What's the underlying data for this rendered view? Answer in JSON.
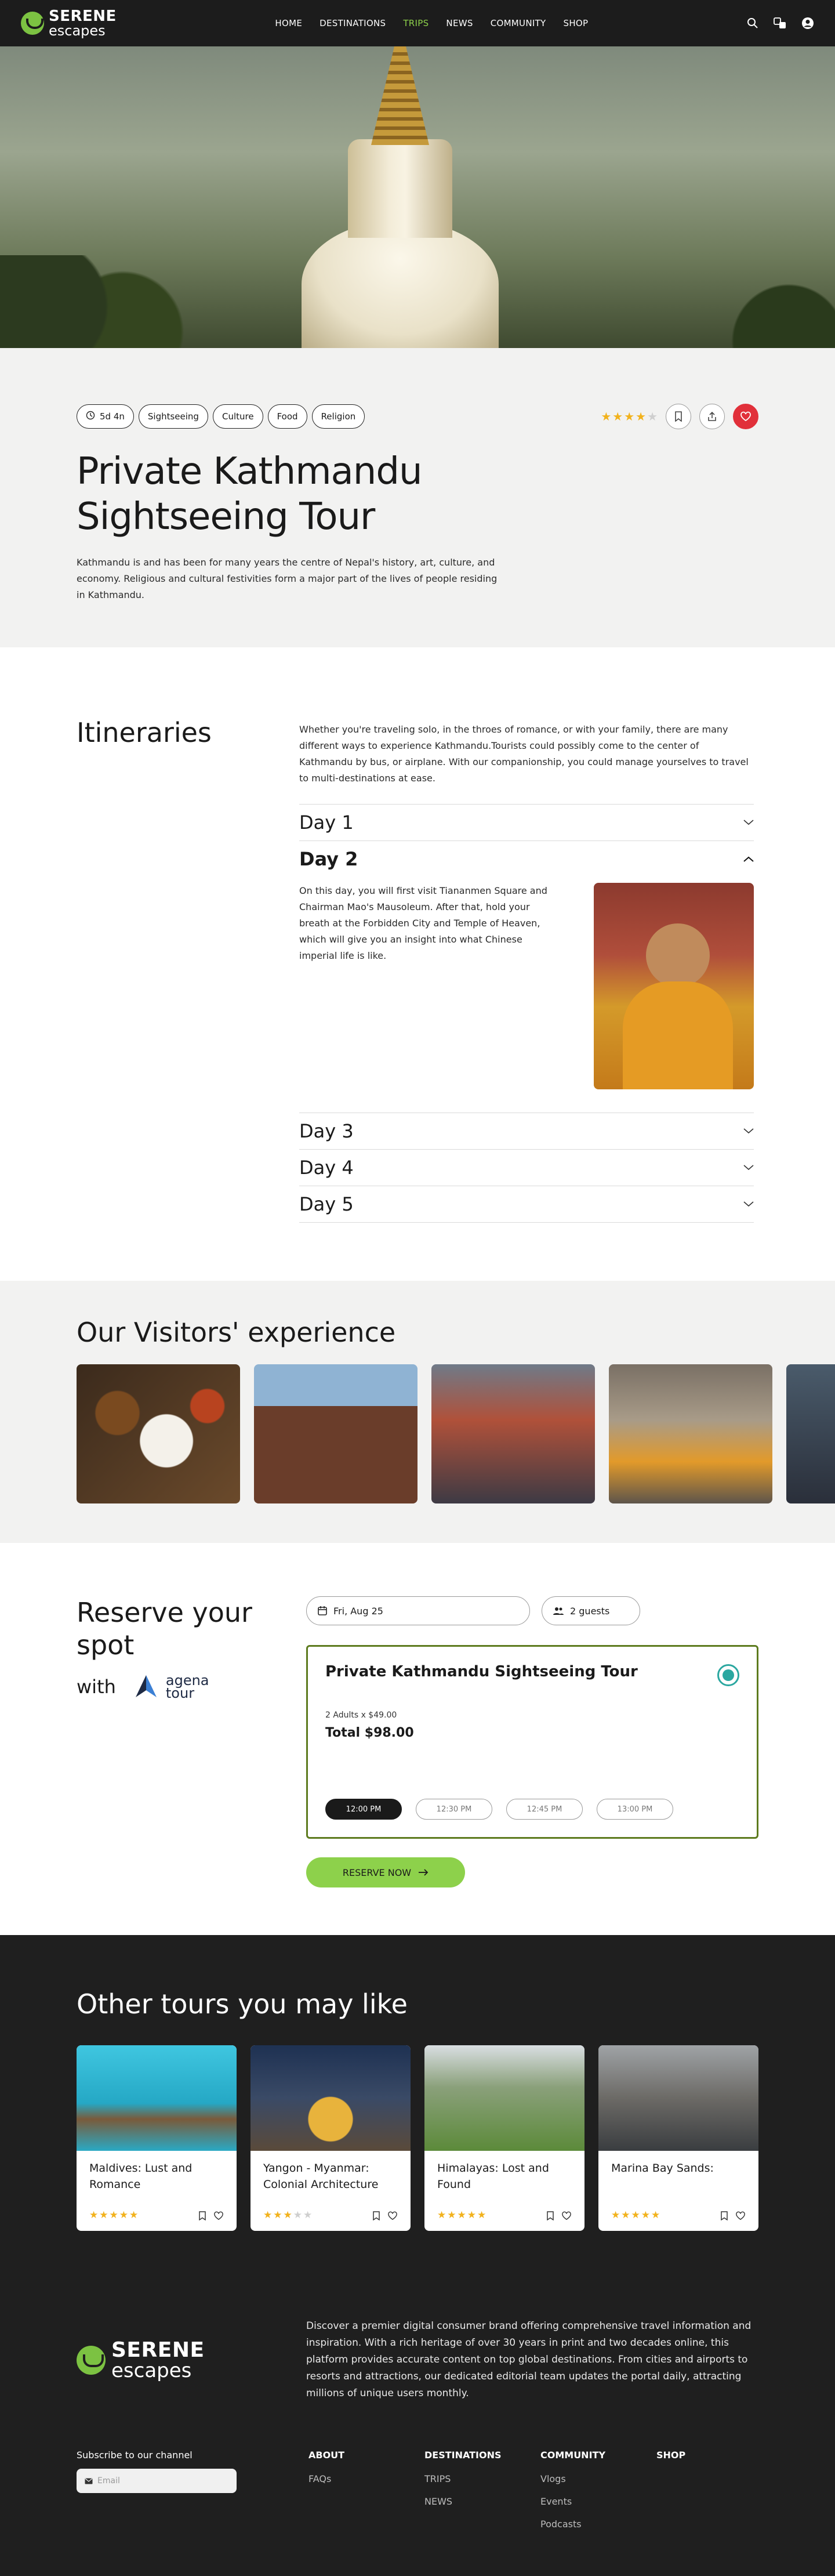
{
  "nav": {
    "logo_line1": "SERENE",
    "logo_line2": "escapes",
    "links": [
      "HOME",
      "DESTINATIONS",
      "TRIPS",
      "NEWS",
      "COMMUNITY",
      "SHOP"
    ],
    "active_link": "TRIPS",
    "icons": [
      "search-icon",
      "translate-icon",
      "account-icon"
    ]
  },
  "tour": {
    "tags": [
      "5d 4n",
      "Sightseeing",
      "Culture",
      "Food",
      "Religion"
    ],
    "rating": 4,
    "rating_max": 5,
    "title": "Private Kathmandu Sightseeing Tour",
    "description": "Kathmandu is and has been for many years the centre of Nepal's history, art, culture, and economy. Religious and cultural festivities form a major part of the lives of people residing in Kathmandu."
  },
  "itineraries": {
    "heading": "Itineraries",
    "intro": "Whether you're traveling solo, in the throes of romance, or with your family, there are many different ways to experience Kathmandu.Tourists could possibly come to the center of Kathmandu by bus, or airplane. With our companionship, you could manage yourselves to travel to multi-destinations at ease.",
    "days": [
      "Day 1",
      "Day 2",
      "Day 3",
      "Day 4",
      "Day 5"
    ],
    "open_day_text": "On this day, you will first visit Tiananmen Square and Chairman Mao's Mausoleum. After that, hold your breath at the Forbidden City and Temple of Heaven, which will give you an insight into what Chinese imperial life is like."
  },
  "visitors": {
    "heading": "Our Visitors' experience"
  },
  "reserve": {
    "heading": "Reserve your spot",
    "with_label": "with",
    "partner_line1": "agena",
    "partner_line2": "tour",
    "date_value": "Fri, Aug 25",
    "guests_value": "2 guests",
    "card_title": "Private Kathmandu Sightseeing Tour",
    "price_line": "2 Adults x $49.00",
    "total": "Total $98.00",
    "time_slots": [
      "12:00 PM",
      "12:30 PM",
      "12:45 PM",
      "13:00 PM"
    ],
    "selected_slot": "12:00 PM",
    "button_label": "RESERVE NOW",
    "accent_color": "#8dd14b",
    "border_color": "#5d7b1e"
  },
  "other_tours": {
    "heading": "Other tours you may like",
    "items": [
      {
        "name": "Maldives: Lust and Romance",
        "rating": 5
      },
      {
        "name": "Yangon - Myanmar: Colonial Architecture",
        "rating": 3
      },
      {
        "name": "Himalayas: Lost and Found",
        "rating": 5
      },
      {
        "name": "Marina Bay Sands:",
        "rating": 5
      }
    ]
  },
  "footer": {
    "logo_line1": "SERENE",
    "logo_line2": "escapes",
    "about": "Discover a premier digital consumer brand offering comprehensive travel information and inspiration. With a rich heritage of over 30 years in print and two decades online, this platform provides accurate content on top global destinations. From cities and airports to resorts and attractions, our dedicated editorial team updates the portal daily, attracting millions of unique users monthly.",
    "subscribe_label": "Subscribe to our channel",
    "email_placeholder": "Email",
    "columns": [
      {
        "heading": "ABOUT",
        "items": [
          "FAQs"
        ]
      },
      {
        "heading": "DESTINATIONS",
        "items": [
          "TRIPS",
          "NEWS"
        ]
      },
      {
        "heading": "COMMUNITY",
        "items": [
          "Vlogs",
          "Events",
          "Podcasts"
        ]
      },
      {
        "heading": "SHOP",
        "items": []
      }
    ]
  }
}
